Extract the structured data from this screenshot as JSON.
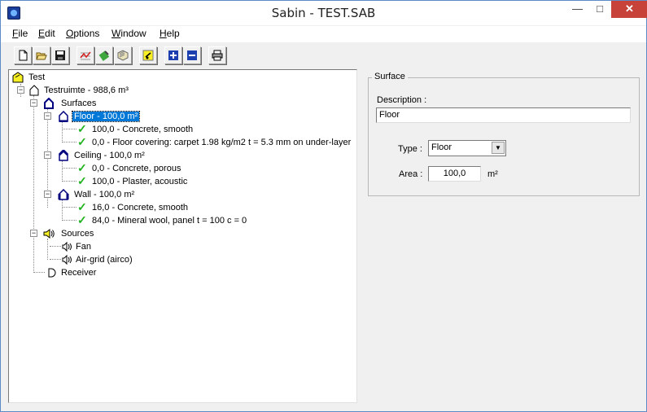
{
  "window": {
    "title": "Sabin - TEST.SAB"
  },
  "menu": [
    {
      "key": "F",
      "rest": "ile"
    },
    {
      "key": "E",
      "rest": "dit"
    },
    {
      "key": "O",
      "rest": "ptions"
    },
    {
      "key": "W",
      "rest": "indow"
    },
    {
      "key": "H",
      "rest": "elp"
    }
  ],
  "toolbar": {
    "buttons": [
      "new-icon",
      "open-icon",
      "save-icon",
      "graph-icon",
      "edit-material-icon",
      "material-library-icon",
      "wizard-icon",
      "add-icon",
      "remove-icon",
      "print-icon"
    ]
  },
  "tree": {
    "root": "Test",
    "room": "Testruimte - 988,6 m³",
    "surfaces": "Surfaces",
    "floor": "Floor - 100,0 m²",
    "floor_items": [
      "100,0 - Concrete, smooth",
      "0,0 - Floor covering: carpet 1.98 kg/m2  t = 5.3 mm on under-layer"
    ],
    "ceiling": "Ceiling - 100,0 m²",
    "ceiling_items": [
      "0,0 - Concrete, porous",
      "100,0 - Plaster, acoustic"
    ],
    "wall": "Wall - 100,0 m²",
    "wall_items": [
      "16,0 - Concrete, smooth",
      "84,0 - Mineral wool, panel  t = 100  c = 0"
    ],
    "sources": "Sources",
    "source_items": [
      "Fan",
      "Air-grid (airco)"
    ],
    "receiver": "Receiver"
  },
  "surface_panel": {
    "group_title": "Surface",
    "description_label": "Description :",
    "description_value": "Floor",
    "type_label": "Type :",
    "type_value": "Floor",
    "area_label": "Area :",
    "area_value": "100,0",
    "area_unit": "m²"
  },
  "colors": {
    "selection": "#0078d7",
    "check": "#1fb31f",
    "close_button": "#c7433a"
  }
}
